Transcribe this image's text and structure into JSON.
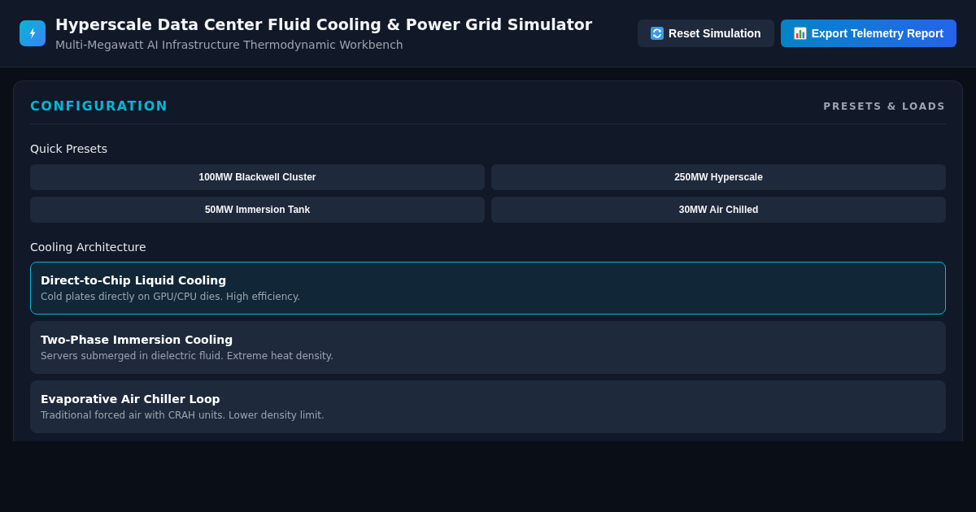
{
  "header": {
    "title": "Hyperscale Data Center Fluid Cooling & Power Grid Simulator",
    "subtitle": "Multi-Megawatt AI Infrastructure Thermodynamic Workbench",
    "buttons": [
      {
        "label": "Reset Simulation",
        "kind": "secondary"
      },
      {
        "label": "Export Telemetry Report",
        "kind": "primary"
      }
    ]
  },
  "panel": {
    "title": "CONFIGURATION",
    "tag": "PRESETS & LOADS",
    "presets": {
      "label": "Quick Presets",
      "buttons": [
        "100MW Blackwell Cluster",
        "250MW Hyperscale",
        "50MW Immersion Tank",
        "30MW Air Chilled"
      ]
    },
    "cooling": {
      "label": "Cooling Architecture",
      "options": [
        {
          "title": "Direct-to-Chip Liquid Cooling",
          "description": "Cold plates directly on GPU/CPU dies. High efficiency.",
          "selected": true
        },
        {
          "title": "Two-Phase Immersion Cooling",
          "description": "Servers submerged in dielectric fluid. Extreme heat density.",
          "selected": false
        },
        {
          "title": "Evaporative Air Chiller Loop",
          "description": "Traditional forced air with CRAH units. Lower density limit.",
          "selected": false
        }
      ]
    }
  }
}
